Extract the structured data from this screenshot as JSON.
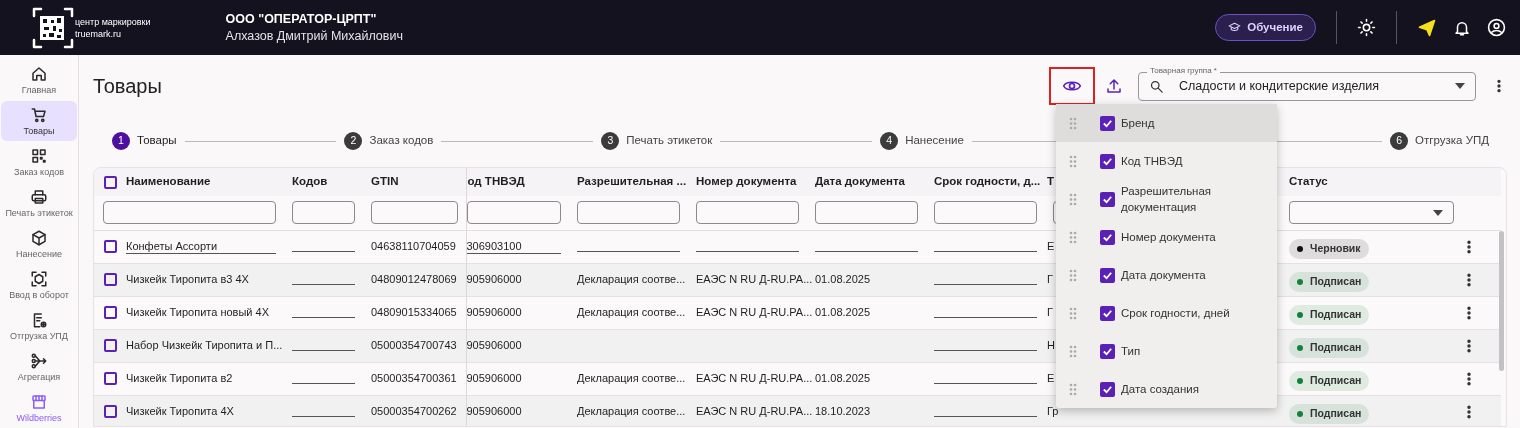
{
  "header": {
    "logo_line_1": "центр маркировки",
    "logo_line_2": "truemark.ru",
    "organization": "ООО \"ОПЕРАТОР-ЦРПТ\"",
    "user": "Алхазов Дмитрий Михайлович",
    "learn_button": "Обучение"
  },
  "sidebar": {
    "items": [
      {
        "label": "Главная",
        "selected": false,
        "accent": false
      },
      {
        "label": "Товары",
        "selected": true,
        "accent": false
      },
      {
        "label": "Заказ кодов",
        "selected": false,
        "accent": false
      },
      {
        "label": "Печать этикеток",
        "selected": false,
        "accent": false
      },
      {
        "label": "Нанесение",
        "selected": false,
        "accent": false
      },
      {
        "label": "Ввод в оборот",
        "selected": false,
        "accent": false
      },
      {
        "label": "Отгрузка УПД",
        "selected": false,
        "accent": false
      },
      {
        "label": "Агрегация",
        "selected": false,
        "accent": false
      },
      {
        "label": "Wildberries",
        "selected": false,
        "accent": true
      }
    ]
  },
  "page": {
    "title": "Товары",
    "product_group": {
      "label": "Товарная группа *",
      "value": "Сладости и кондитерские изделия"
    }
  },
  "stepper": [
    {
      "number": "1",
      "label": "Товары",
      "selected": true
    },
    {
      "number": "2",
      "label": "Заказ кодов",
      "selected": false
    },
    {
      "number": "3",
      "label": "Печать этикеток",
      "selected": false
    },
    {
      "number": "4",
      "label": "Нанесение",
      "selected": false
    },
    {
      "number": "6",
      "label": "Отгрузка УПД",
      "selected": false
    }
  ],
  "table": {
    "select_all_checked": false,
    "columns": [
      "Наименование",
      "Кодов",
      "GTIN",
      "од ТНВЭД",
      "Разрешительная ...",
      "Номер документа",
      "Дата документа",
      "Срок годности, д...",
      "Т",
      "Статус"
    ],
    "rows": [
      {
        "checked": false,
        "cells": [
          {
            "kind": "link",
            "text": "Конфеты Ассорти"
          },
          {
            "kind": "line"
          },
          {
            "kind": "text",
            "text": "04638110704059"
          },
          {
            "kind": "link",
            "text": "306903100"
          },
          {
            "kind": "line"
          },
          {
            "kind": "line"
          },
          {
            "kind": "line"
          },
          {
            "kind": "line"
          },
          {
            "kind": "text",
            "text": "Е"
          }
        ],
        "status": {
          "label": "Черновик",
          "color": "#111111"
        }
      },
      {
        "checked": false,
        "cells": [
          {
            "kind": "text",
            "text": "Чизкейк Тиропита в3 4Х"
          },
          {
            "kind": "line"
          },
          {
            "kind": "text",
            "text": "04809012478069"
          },
          {
            "kind": "text",
            "text": "905906000"
          },
          {
            "kind": "text",
            "text": "Декларация соотве..."
          },
          {
            "kind": "text",
            "text": "ЕАЭС N RU Д-RU.PA..."
          },
          {
            "kind": "text",
            "text": "01.08.2025"
          },
          {
            "kind": "line"
          },
          {
            "kind": "text",
            "text": "Г"
          }
        ],
        "status": {
          "label": "Подписан",
          "color": "#15803d"
        }
      },
      {
        "checked": false,
        "cells": [
          {
            "kind": "text",
            "text": "Чизкейк Тиропита новый 4Х"
          },
          {
            "kind": "line"
          },
          {
            "kind": "text",
            "text": "04809015334065"
          },
          {
            "kind": "text",
            "text": "905906000"
          },
          {
            "kind": "text",
            "text": "Декларация соотве..."
          },
          {
            "kind": "text",
            "text": "ЕАЭС N RU Д-RU.PA..."
          },
          {
            "kind": "text",
            "text": "01.08.2025"
          },
          {
            "kind": "line"
          },
          {
            "kind": "text",
            "text": "Г"
          }
        ],
        "status": {
          "label": "Подписан",
          "color": "#15803d"
        }
      },
      {
        "checked": false,
        "cells": [
          {
            "kind": "text",
            "text": "Набор Чизкейк Тиропита и П..."
          },
          {
            "kind": "line"
          },
          {
            "kind": "text",
            "text": "05000354700743"
          },
          {
            "kind": "text",
            "text": "905906000"
          },
          {
            "kind": "empty"
          },
          {
            "kind": "empty"
          },
          {
            "kind": "empty"
          },
          {
            "kind": "line"
          },
          {
            "kind": "text",
            "text": "Н"
          }
        ],
        "status": {
          "label": "Подписан",
          "color": "#15803d"
        }
      },
      {
        "checked": false,
        "cells": [
          {
            "kind": "text",
            "text": "Чизкейк Тиропита в2"
          },
          {
            "kind": "line"
          },
          {
            "kind": "text",
            "text": "05000354700361"
          },
          {
            "kind": "text",
            "text": "905906000"
          },
          {
            "kind": "text",
            "text": "Декларация соотве..."
          },
          {
            "kind": "text",
            "text": "ЕАЭС N RU Д-RU.PA..."
          },
          {
            "kind": "text",
            "text": "01.08.2025"
          },
          {
            "kind": "line"
          },
          {
            "kind": "text",
            "text": "Е"
          }
        ],
        "status": {
          "label": "Подписан",
          "color": "#15803d"
        }
      },
      {
        "checked": false,
        "cells": [
          {
            "kind": "text",
            "text": "Чизкейк Тиропита 4Х"
          },
          {
            "kind": "line"
          },
          {
            "kind": "text",
            "text": "05000354700262"
          },
          {
            "kind": "text",
            "text": "905906000"
          },
          {
            "kind": "text",
            "text": "Декларация соотве..."
          },
          {
            "kind": "text",
            "text": "ЕАЭС N RU Д-RU.PA..."
          },
          {
            "kind": "text",
            "text": "18.10.2023"
          },
          {
            "kind": "line"
          },
          {
            "kind": "text",
            "text": "Гр"
          }
        ],
        "status": {
          "label": "Подписан",
          "color": "#15803d"
        }
      }
    ]
  },
  "column_menu": [
    {
      "label": "Бренд",
      "checked": true,
      "hovered": true
    },
    {
      "label": "Код ТНВЭД",
      "checked": true,
      "hovered": false
    },
    {
      "label": "Разрешительная документация",
      "checked": true,
      "hovered": false
    },
    {
      "label": "Номер документа",
      "checked": true,
      "hovered": false
    },
    {
      "label": "Дата документа",
      "checked": true,
      "hovered": false
    },
    {
      "label": "Срок годности, дней",
      "checked": true,
      "hovered": false
    },
    {
      "label": "Тип",
      "checked": true,
      "hovered": false
    },
    {
      "label": "Дата создания",
      "checked": true,
      "hovered": false
    }
  ]
}
